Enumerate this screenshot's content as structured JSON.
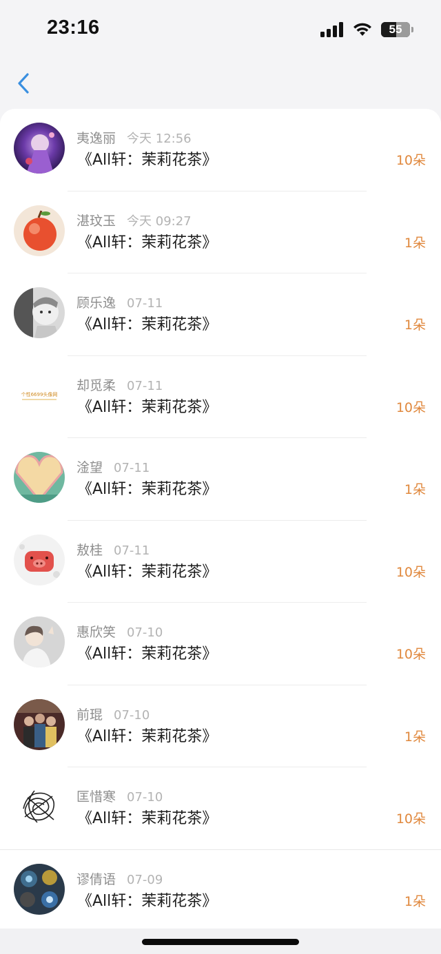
{
  "status_bar": {
    "time": "23:16",
    "battery": "55"
  },
  "nav": {
    "back_icon": "chevron-left-icon"
  },
  "accent_color": "#e0883d",
  "items": [
    {
      "name": "夷逸丽",
      "date": "今天 12:56",
      "title": "《All轩：茉莉花茶》",
      "count": "10朵"
    },
    {
      "name": "湛玟玉",
      "date": "今天 09:27",
      "title": "《All轩：茉莉花茶》",
      "count": "1朵"
    },
    {
      "name": "顾乐逸",
      "date": "07-11",
      "title": "《All轩：茉莉花茶》",
      "count": "1朵"
    },
    {
      "name": "却觅柔",
      "date": "07-11",
      "title": "《All轩：茉莉花茶》",
      "count": "10朵",
      "avatar_text": "个性6699头像网"
    },
    {
      "name": "淦望",
      "date": "07-11",
      "title": "《All轩：茉莉花茶》",
      "count": "1朵"
    },
    {
      "name": "敖桂",
      "date": "07-11",
      "title": "《All轩：茉莉花茶》",
      "count": "10朵"
    },
    {
      "name": "惠欣笑",
      "date": "07-10",
      "title": "《All轩：茉莉花茶》",
      "count": "10朵"
    },
    {
      "name": "前琨",
      "date": "07-10",
      "title": "《All轩：茉莉花茶》",
      "count": "1朵"
    },
    {
      "name": "匡惜寒",
      "date": "07-10",
      "title": "《All轩：茉莉花茶》",
      "count": "10朵"
    },
    {
      "name": "谬倩语",
      "date": "07-09",
      "title": "《All轩：茉莉花茶》",
      "count": "1朵"
    }
  ]
}
